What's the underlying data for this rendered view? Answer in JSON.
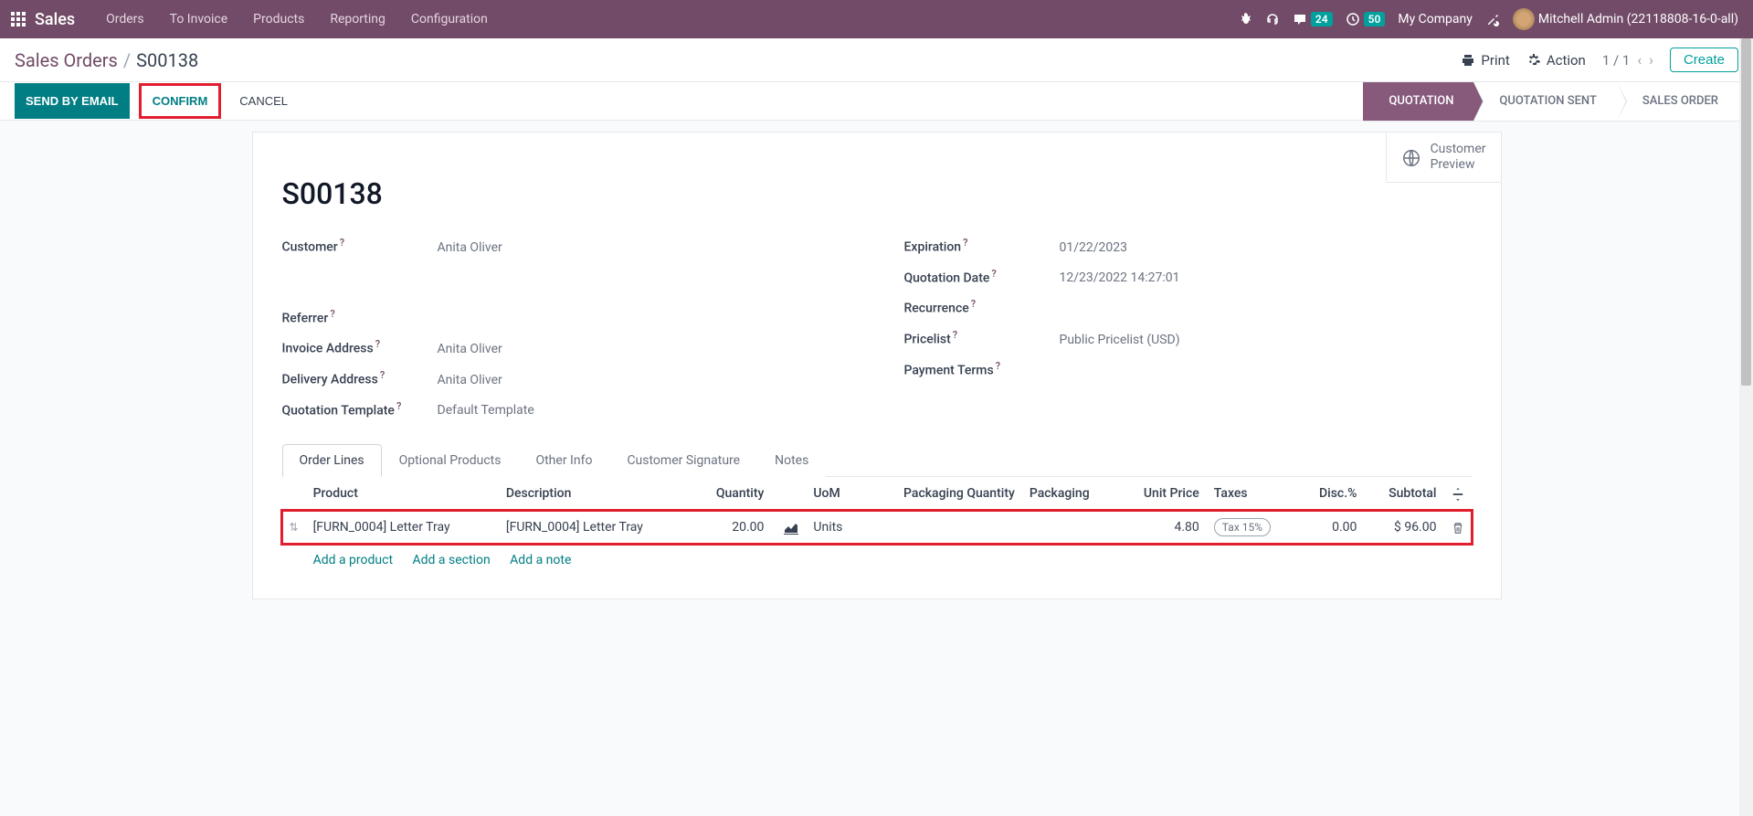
{
  "navbar": {
    "brand": "Sales",
    "menu": [
      "Orders",
      "To Invoice",
      "Products",
      "Reporting",
      "Configuration"
    ],
    "messages_badge": "24",
    "activities_badge": "50",
    "company": "My Company",
    "user": "Mitchell Admin (22118808-16-0-all)"
  },
  "breadcrumb": {
    "parent": "Sales Orders",
    "current": "S00138"
  },
  "controls": {
    "print": "Print",
    "action": "Action",
    "pager": "1 / 1",
    "create": "Create"
  },
  "statusbar": {
    "send_email": "SEND BY EMAIL",
    "confirm": "CONFIRM",
    "cancel": "CANCEL",
    "stages": [
      "QUOTATION",
      "QUOTATION SENT",
      "SALES ORDER"
    ],
    "active_stage": 0
  },
  "button_box": {
    "customer_preview_l1": "Customer",
    "customer_preview_l2": "Preview"
  },
  "order": {
    "name": "S00138",
    "fields_left": {
      "customer_label": "Customer",
      "customer_value": "Anita Oliver",
      "referrer_label": "Referrer",
      "referrer_value": "",
      "invoice_address_label": "Invoice Address",
      "invoice_address_value": "Anita Oliver",
      "delivery_address_label": "Delivery Address",
      "delivery_address_value": "Anita Oliver",
      "quotation_template_label": "Quotation Template",
      "quotation_template_value": "Default Template"
    },
    "fields_right": {
      "expiration_label": "Expiration",
      "expiration_value": "01/22/2023",
      "quotation_date_label": "Quotation Date",
      "quotation_date_value": "12/23/2022 14:27:01",
      "recurrence_label": "Recurrence",
      "recurrence_value": "",
      "pricelist_label": "Pricelist",
      "pricelist_value": "Public Pricelist (USD)",
      "payment_terms_label": "Payment Terms",
      "payment_terms_value": ""
    }
  },
  "tabs": [
    "Order Lines",
    "Optional Products",
    "Other Info",
    "Customer Signature",
    "Notes"
  ],
  "table": {
    "headers": {
      "product": "Product",
      "description": "Description",
      "quantity": "Quantity",
      "uom": "UoM",
      "packaging_qty": "Packaging Quantity",
      "packaging": "Packaging",
      "unit_price": "Unit Price",
      "taxes": "Taxes",
      "disc": "Disc.%",
      "subtotal": "Subtotal"
    },
    "rows": [
      {
        "product": "[FURN_0004] Letter Tray",
        "description": "[FURN_0004] Letter Tray",
        "quantity": "20.00",
        "uom": "Units",
        "packaging_qty": "",
        "packaging": "",
        "unit_price": "4.80",
        "taxes": "Tax 15%",
        "disc": "0.00",
        "subtotal": "$ 96.00"
      }
    ],
    "add_product": "Add a product",
    "add_section": "Add a section",
    "add_note": "Add a note"
  }
}
